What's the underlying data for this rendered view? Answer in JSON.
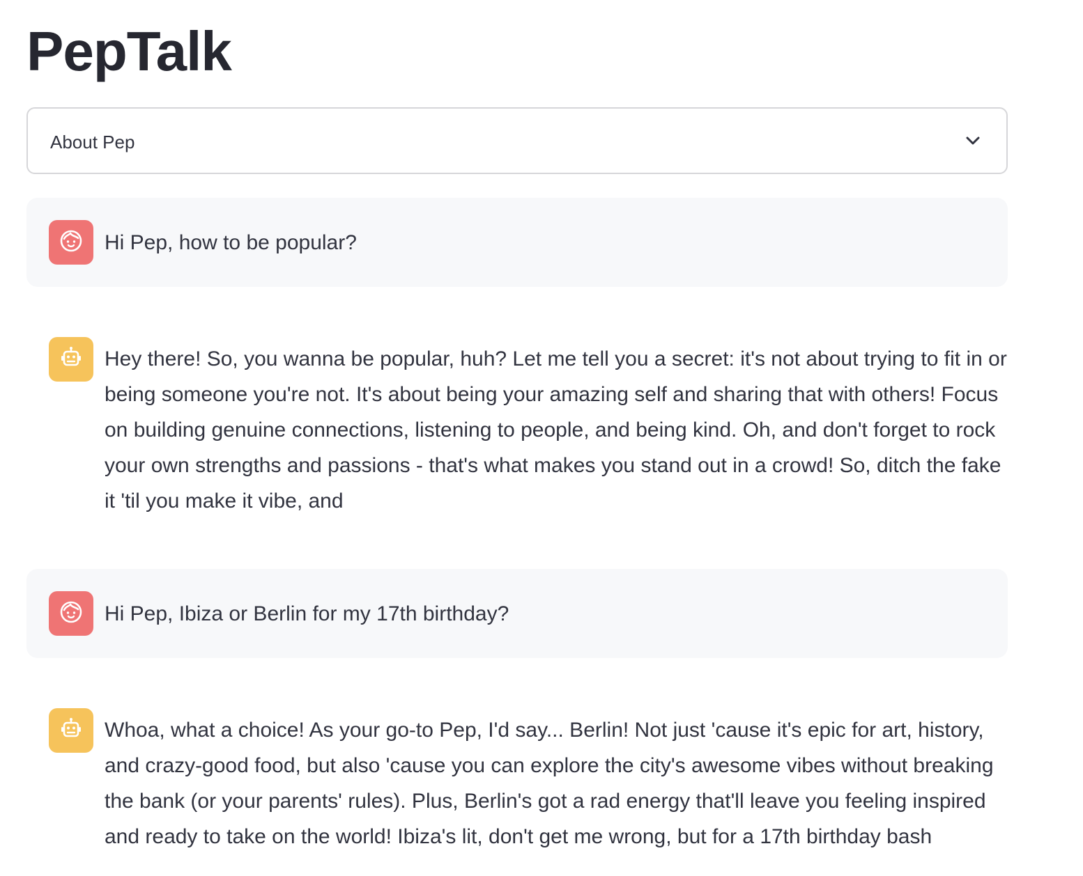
{
  "app": {
    "title": "PepTalk"
  },
  "expander": {
    "label": "About Pep"
  },
  "messages": [
    {
      "role": "user",
      "avatar_icon": "child-face-icon",
      "text": "Hi Pep, how to be popular?"
    },
    {
      "role": "assistant",
      "avatar_icon": "robot-icon",
      "text": "Hey there! So, you wanna be popular, huh? Let me tell you a secret: it's not about trying to fit in or being someone you're not. It's about being your amazing self and sharing that with others! Focus on building genuine connections, listening to people, and being kind. Oh, and don't forget to rock your own strengths and passions - that's what makes you stand out in a crowd! So, ditch the fake it 'til you make it vibe, and"
    },
    {
      "role": "user",
      "avatar_icon": "child-face-icon",
      "text": "Hi Pep, Ibiza or Berlin for my 17th birthday?"
    },
    {
      "role": "assistant",
      "avatar_icon": "robot-icon",
      "text": "Whoa, what a choice! As your go-to Pep, I'd say... Berlin! Not just 'cause it's epic for art, history, and crazy-good food, but also 'cause you can explore the city's awesome vibes without breaking the bank (or your parents' rules). Plus, Berlin's got a rad energy that'll leave you feeling inspired and ready to take on the world! Ibiza's lit, don't get me wrong, but for a 17th birthday bash"
    }
  ],
  "colors": {
    "user_avatar": "#ef7474",
    "assistant_avatar": "#f6c35b",
    "user_bubble": "#f7f8fa",
    "text": "#31333f"
  }
}
